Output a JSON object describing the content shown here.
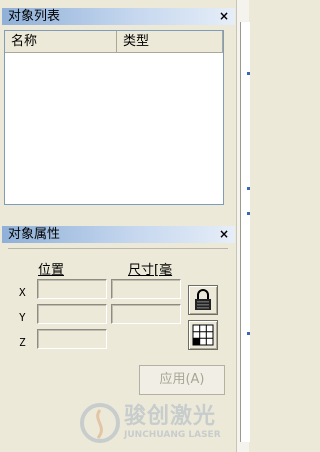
{
  "object_list_panel": {
    "title": "对象列表",
    "close_glyph": "×",
    "columns": [
      "名称",
      "类型"
    ]
  },
  "object_properties_panel": {
    "title": "对象属性",
    "close_glyph": "×",
    "position_label": "位置",
    "size_label": "尺寸[毫",
    "axes": [
      "X",
      "Y",
      "Z"
    ],
    "apply_label": "应用(A)"
  },
  "watermark": {
    "brand": "骏创激光",
    "sub": "JUNCHUANG LASER"
  }
}
